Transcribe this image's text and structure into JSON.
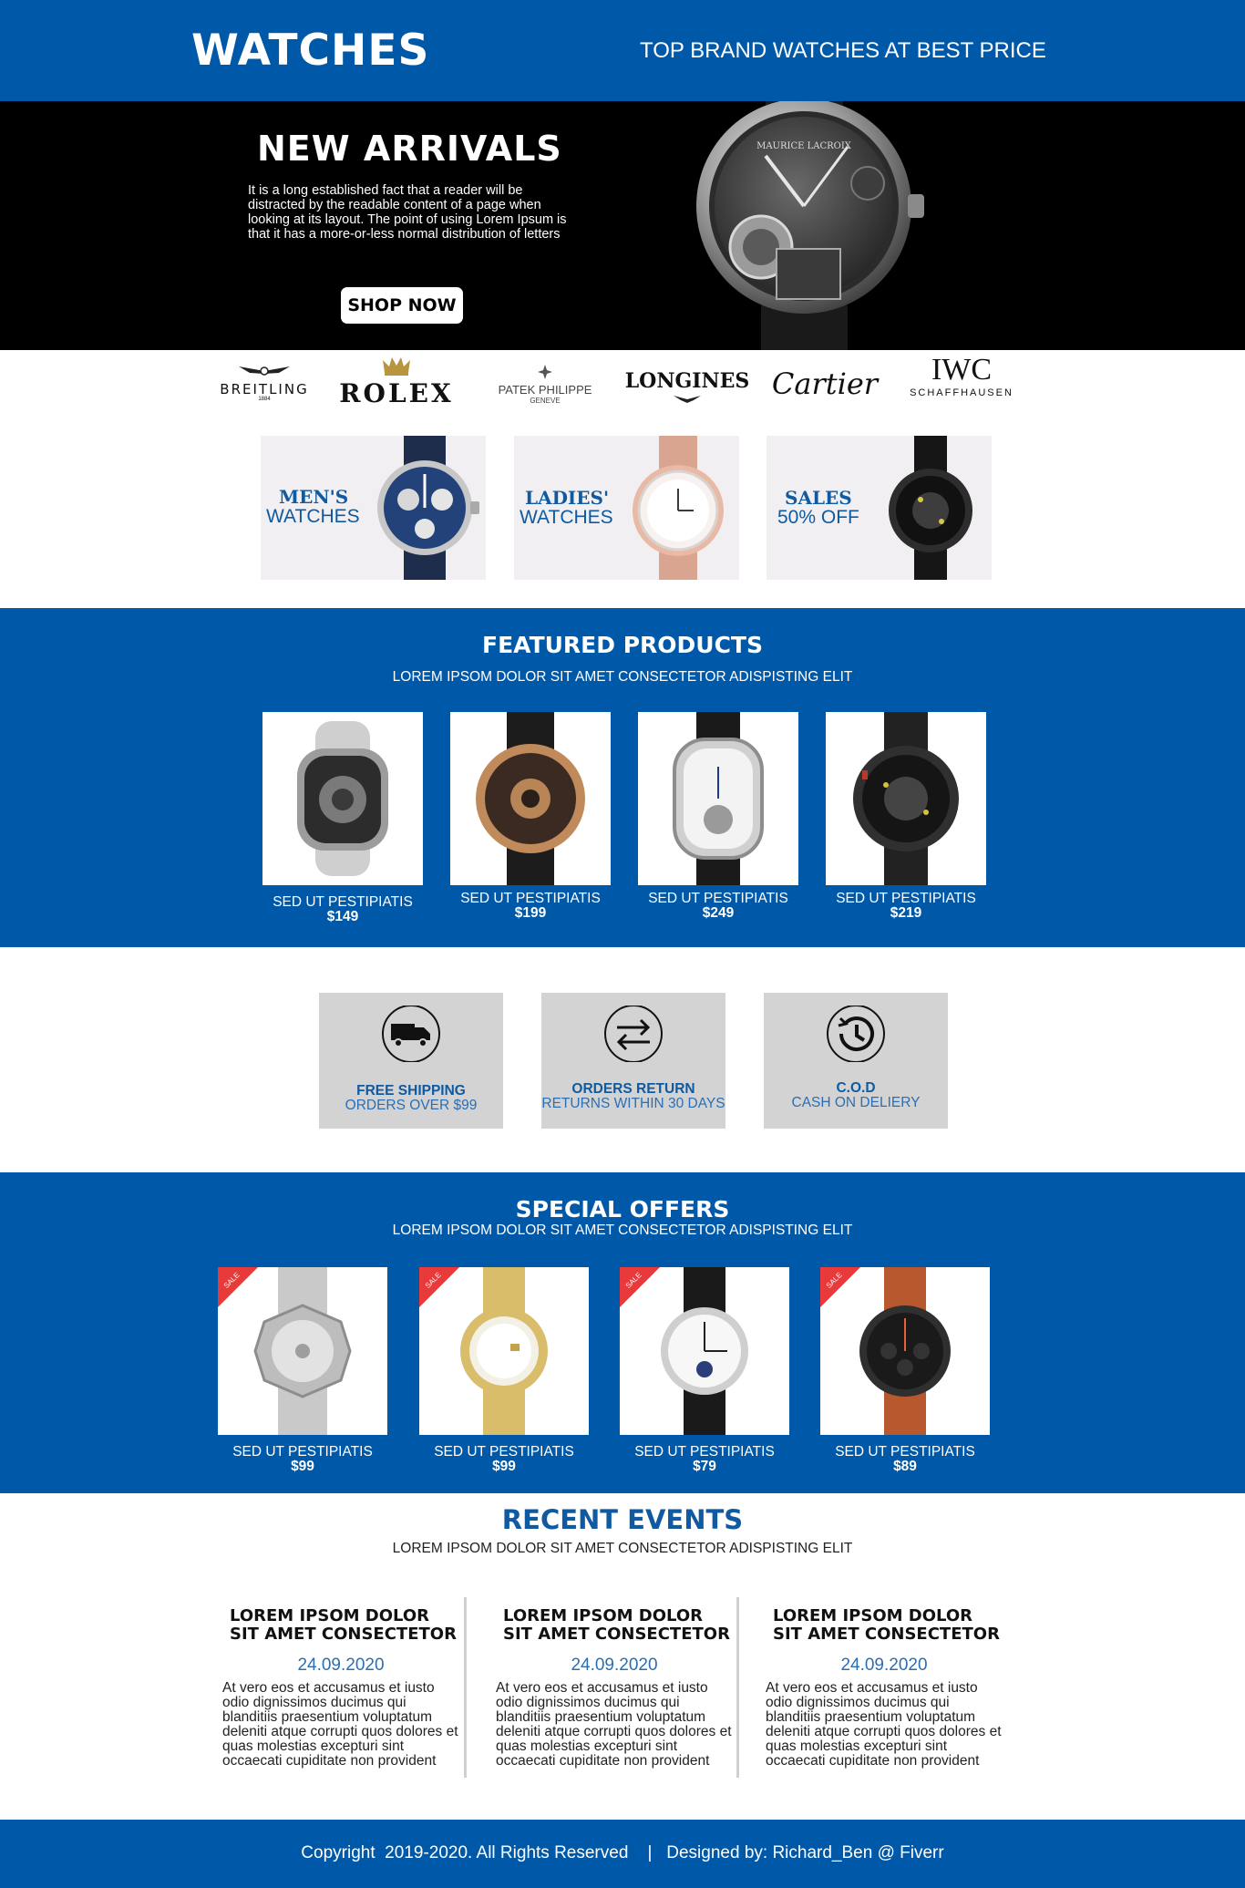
{
  "header": {
    "logo": "WATCHES",
    "tagline": "TOP BRAND WATCHES AT BEST PRICE",
    "accent_color": "#0059a8"
  },
  "hero": {
    "title": "NEW ARRIVALS",
    "text": "It is a long established fact that a reader will be distracted by the readable content of a page when looking at its layout. The point of using Lorem Ipsum is that it has a more-or-less normal distribution of letters",
    "button": "SHOP NOW",
    "watch_brand": "MAURICE LACROIX"
  },
  "brands": [
    {
      "name": "BREITLING",
      "sub": "1884"
    },
    {
      "name": "ROLEX",
      "sub": ""
    },
    {
      "name": "PATEK PHILIPPE",
      "sub": "GENEVE"
    },
    {
      "name": "LONGINES",
      "sub": ""
    },
    {
      "name": "Cartier",
      "sub": ""
    },
    {
      "name": "IWC",
      "sub": "SCHAFFHAUSEN"
    }
  ],
  "categories": [
    {
      "line1": "MEN'S",
      "line2": "WATCHES"
    },
    {
      "line1": "LADIES'",
      "line2": "WATCHES"
    },
    {
      "line1": "SALES",
      "line2": "50% OFF"
    }
  ],
  "featured": {
    "title": "FEATURED PRODUCTS",
    "subtitle": "LOREM IPSOM DOLOR SIT AMET CONSECTETOR ADISPISTING ELIT",
    "products": [
      {
        "name": "SED UT PESTIPIATIS",
        "price": "$149"
      },
      {
        "name": "SED UT PESTIPIATIS",
        "price": "$199"
      },
      {
        "name": "SED UT PESTIPIATIS",
        "price": "$249"
      },
      {
        "name": "SED UT PESTIPIATIS",
        "price": "$219"
      }
    ]
  },
  "features": [
    {
      "icon": "truck-icon",
      "title": "FREE SHIPPING",
      "subtitle": "ORDERS OVER $99"
    },
    {
      "icon": "exchange-arrows-icon",
      "title": "ORDERS RETURN",
      "subtitle": "RETURNS WITHIN 30 DAYS"
    },
    {
      "icon": "clock-history-icon",
      "title": "C.O.D",
      "subtitle": "CASH ON DELIERY"
    }
  ],
  "offers": {
    "title": "SPECIAL OFFERS",
    "subtitle": "LOREM IPSOM DOLOR SIT AMET CONSECTETOR ADISPISTING ELIT",
    "badge": "SALE",
    "products": [
      {
        "name": "SED UT PESTIPIATIS",
        "price": "$99"
      },
      {
        "name": "SED UT PESTIPIATIS",
        "price": "$99"
      },
      {
        "name": "SED UT PESTIPIATIS",
        "price": "$79"
      },
      {
        "name": "SED UT PESTIPIATIS",
        "price": "$89"
      }
    ]
  },
  "events": {
    "title": "RECENT EVENTS",
    "subtitle": "LOREM IPSOM DOLOR SIT AMET CONSECTETOR ADISPISTING ELIT",
    "items": [
      {
        "heading": "LOREM IPSOM DOLOR SIT AMET CONSECTETOR",
        "date": "24.09.2020",
        "text": "At vero eos et accusamus et iusto odio dignissimos ducimus qui blanditiis praesentium voluptatum deleniti atque corrupti quos dolores et quas molestias excepturi sint occaecati cupiditate non provident"
      },
      {
        "heading": "LOREM IPSOM DOLOR SIT AMET CONSECTETOR",
        "date": "24.09.2020",
        "text": "At vero eos et accusamus et iusto odio dignissimos ducimus qui blanditiis praesentium voluptatum deleniti atque corrupti quos dolores et quas molestias excepturi sint occaecati cupiditate non provident"
      },
      {
        "heading": "LOREM IPSOM DOLOR SIT AMET CONSECTETOR",
        "date": "24.09.2020",
        "text": "At vero eos et accusamus et iusto odio dignissimos ducimus qui blanditiis praesentium voluptatum deleniti atque corrupti quos dolores et quas molestias excepturi sint occaecati cupiditate non provident"
      }
    ]
  },
  "footer": {
    "text": "Copyright  2019-2020. All Rights Reserved    |   Designed by: Richard_Ben @ Fiverr"
  }
}
